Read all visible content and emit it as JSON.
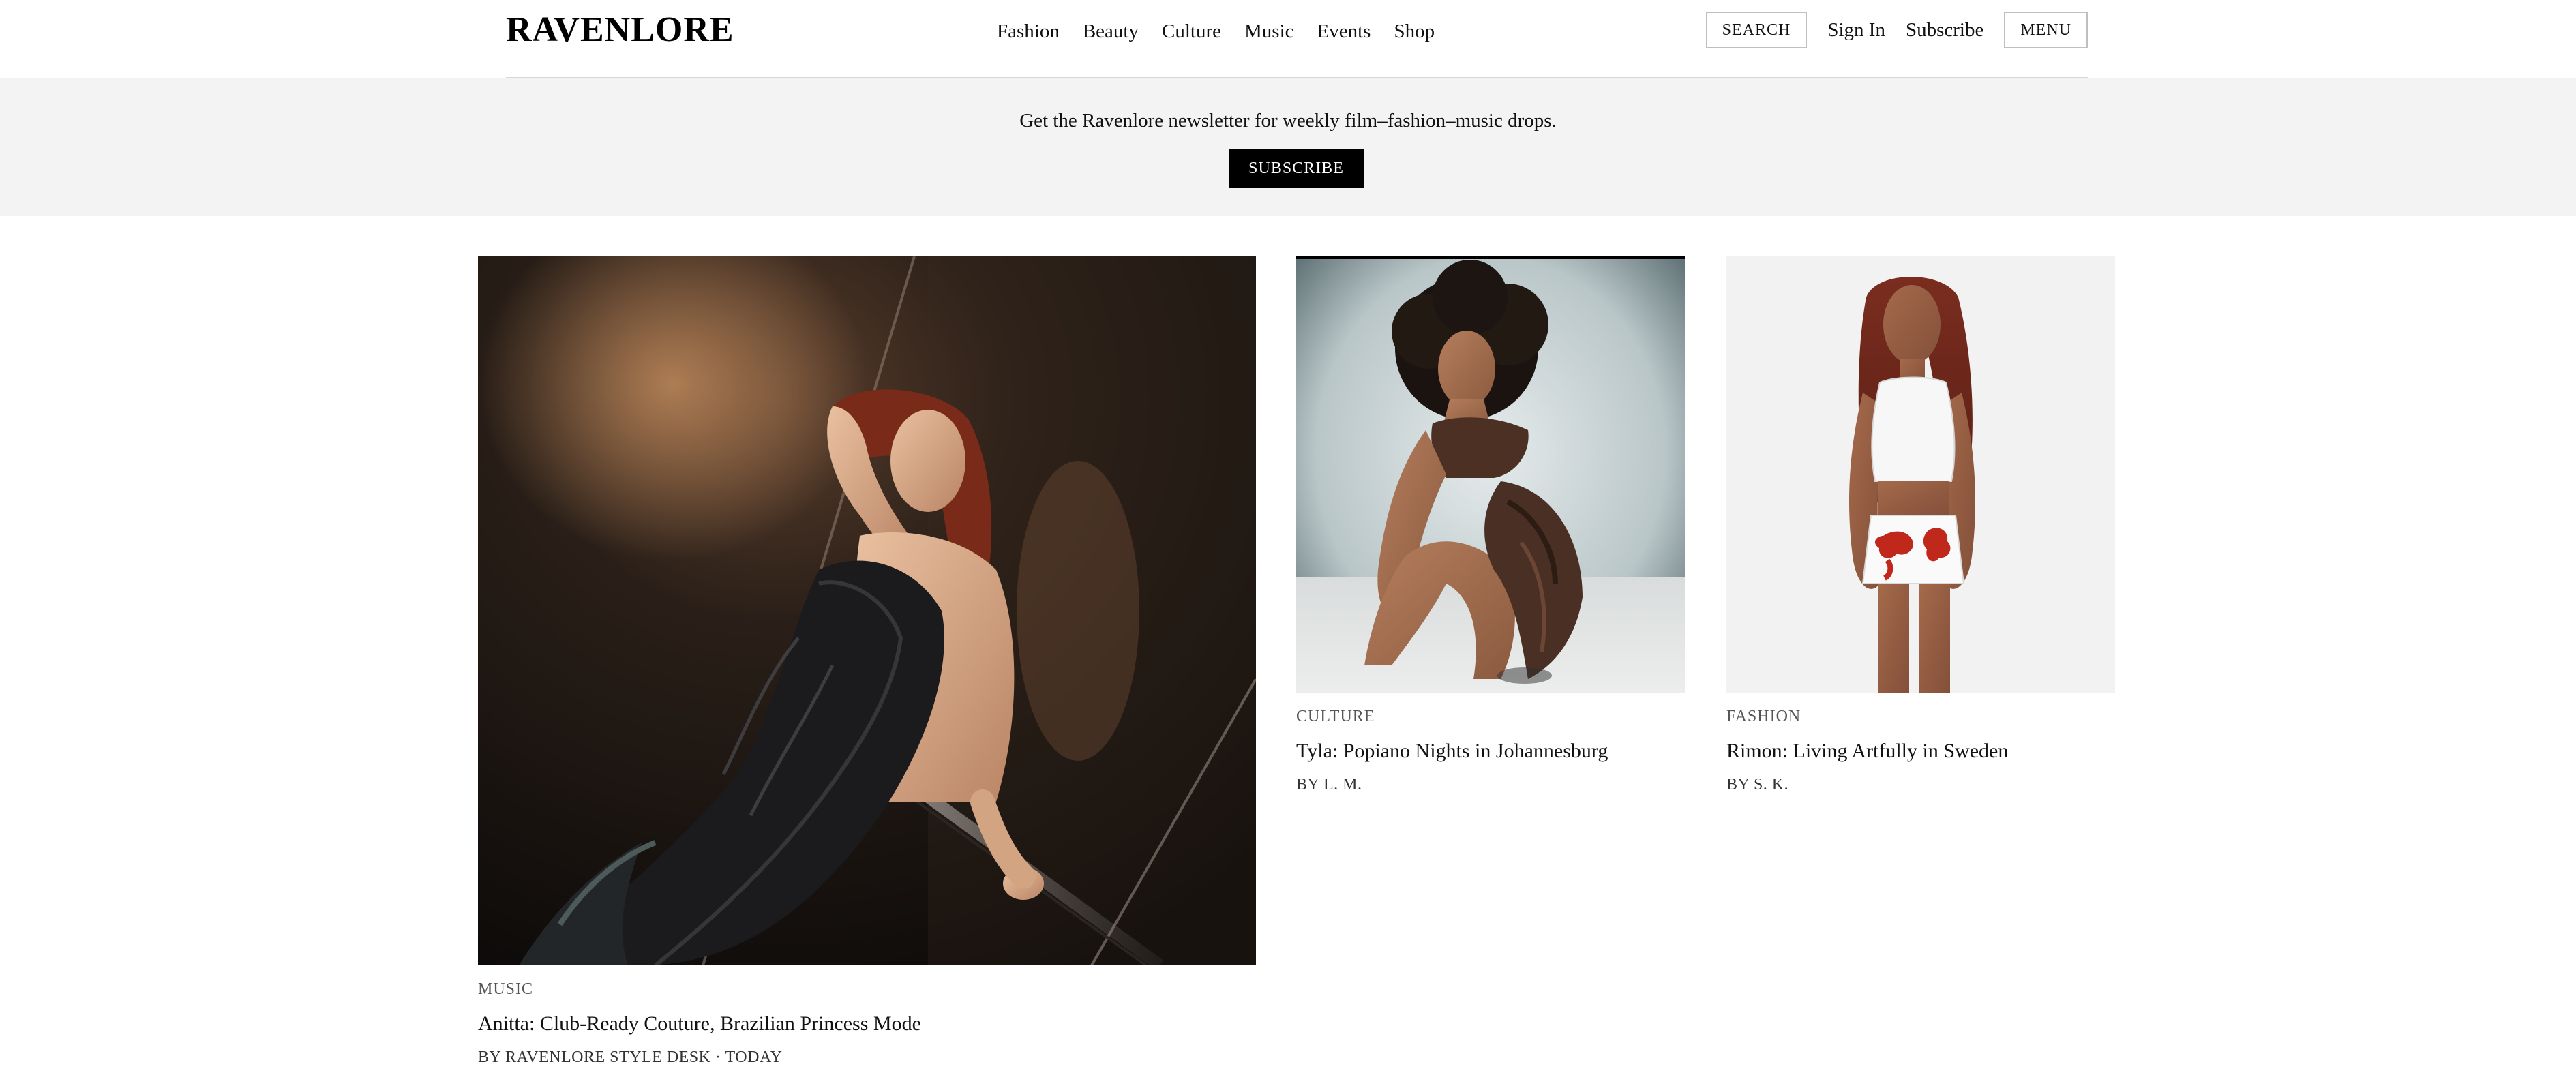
{
  "header": {
    "brand": "RAVENLORE",
    "nav": [
      "Fashion",
      "Beauty",
      "Culture",
      "Music",
      "Events",
      "Shop"
    ],
    "search_label": "SEARCH",
    "signin_label": "Sign In",
    "subscribe_label": "Subscribe",
    "menu_label": "MENU"
  },
  "banner": {
    "text": "Get the Ravenlore newsletter for weekly film–fashion–music drops.",
    "button_label": "SUBSCRIBE"
  },
  "articles": [
    {
      "kicker": "MUSIC",
      "headline": "Anitta: Club-Ready Couture, Brazilian Princess Mode",
      "byline": "BY RAVENLORE STYLE DESK · TODAY",
      "image_icon": "photo-anitta"
    },
    {
      "kicker": "CULTURE",
      "headline": "Tyla: Popiano Nights in Johannesburg",
      "byline": "BY L. M.",
      "image_icon": "photo-tyla"
    },
    {
      "kicker": "FASHION",
      "headline": "Rimon: Living Artfully in Sweden",
      "byline": "BY S. K.",
      "image_icon": "photo-rimon"
    }
  ],
  "colors": {
    "banner_bg": "#f3f3f3",
    "button_bg": "#000000",
    "header_rule": "#d6d6d6"
  }
}
